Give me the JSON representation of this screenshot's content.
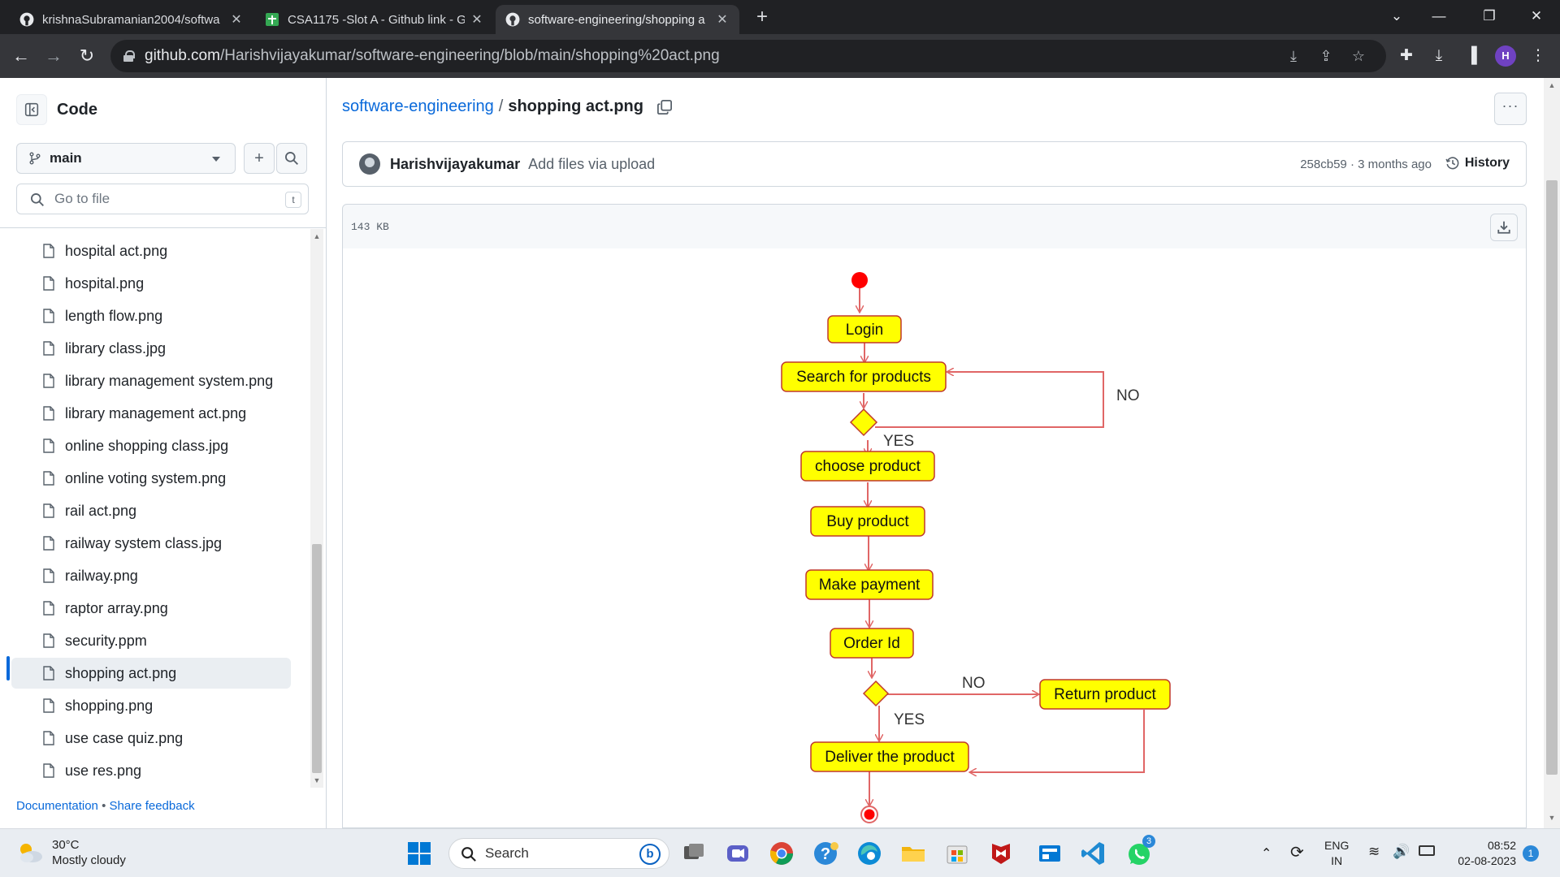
{
  "browser": {
    "tabs": [
      {
        "title": "krishnaSubramanian2004/softwa",
        "active": false,
        "icon": "github-icon"
      },
      {
        "title": "CSA1175 -Slot A - Github link - G",
        "active": false,
        "icon": "sheets-icon"
      },
      {
        "title": "software-engineering/shopping a",
        "active": true,
        "icon": "github-icon"
      }
    ],
    "url_host": "github.com",
    "url_path": "/Harishvijayakumar/software-engineering/blob/main/shopping%20act.png",
    "profile_initial": "H"
  },
  "sidebar": {
    "title": "Code",
    "branch": "main",
    "go_to_file_placeholder": "Go to file",
    "go_to_file_shortcut": "t",
    "files": [
      "hospital act.png",
      "hospital.png",
      "length flow.png",
      "library class.jpg",
      "library management system.png",
      "library management act.png",
      "online shopping class.jpg",
      "online voting system.png",
      "rail act.png",
      "railway system class.jpg",
      "railway.png",
      "raptor array.png",
      "security.ppm",
      "shopping act.png",
      "shopping.png",
      "use case quiz.png",
      "use res.png"
    ],
    "selected_file": "shopping act.png",
    "footer_docs": "Documentation",
    "footer_sep": "•",
    "footer_feedback": "Share feedback"
  },
  "main": {
    "repo": "software-engineering",
    "separator": "/",
    "filename": "shopping act.png",
    "commit": {
      "author": "Harishvijayakumar",
      "message": "Add files via upload",
      "meta": "258cb59 · 3 months ago",
      "history_label": "History"
    },
    "file_size": "143 KB"
  },
  "diagram": {
    "nodes": [
      "Login",
      "Search for products",
      "choose product",
      "Buy product",
      "Make payment",
      "Order Id",
      "Return product",
      "Deliver the product"
    ],
    "labels": {
      "no_1": "NO",
      "yes_1": "YES",
      "no_2": "NO",
      "yes_2": "YES"
    },
    "colors": {
      "node_fill": "#ffff00",
      "node_border": "#c0392b",
      "edge": "#e06666",
      "start_end": "#ff0000"
    }
  },
  "taskbar": {
    "weather_temp": "30°C",
    "weather_desc": "Mostly cloudy",
    "search_placeholder": "Search",
    "lang_1": "ENG",
    "lang_2": "IN",
    "time": "08:52",
    "date": "02-08-2023",
    "notification_count": "1",
    "whatsapp_badge": "3"
  }
}
